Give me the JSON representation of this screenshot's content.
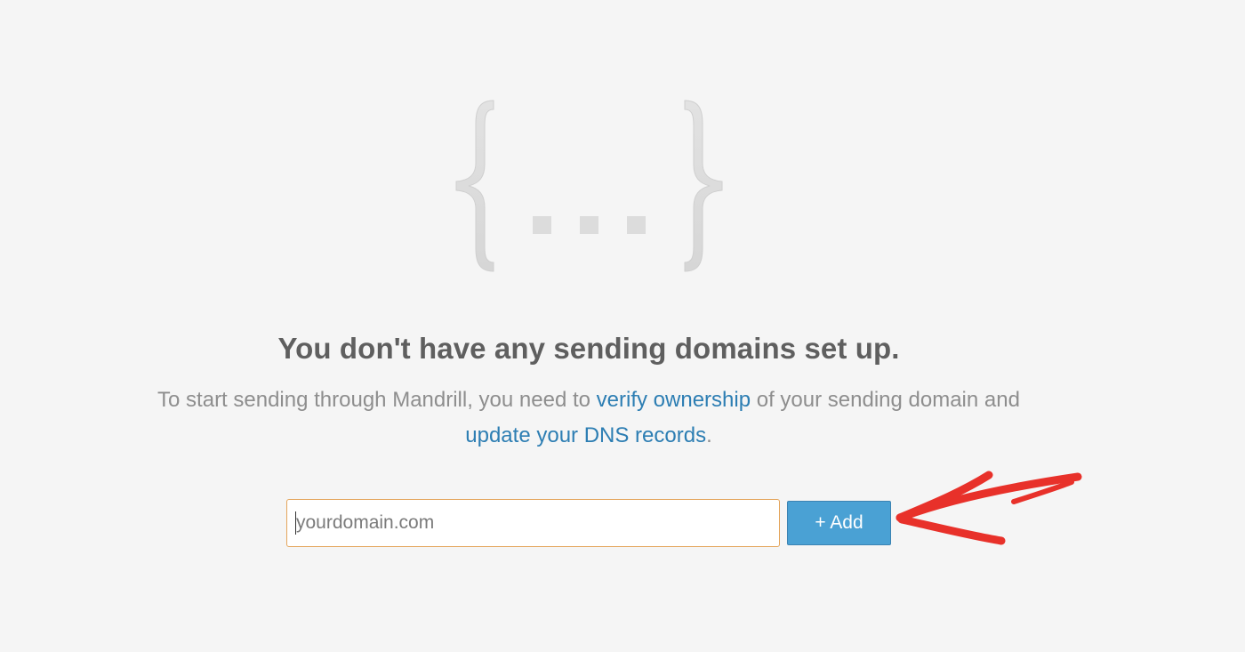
{
  "empty_state": {
    "headline": "You don't have any sending domains set up.",
    "description": {
      "part1": "To start sending through Mandrill, you need to ",
      "link1": "verify ownership",
      "part2": " of your sending domain and ",
      "link2": "update your DNS records",
      "part3": "."
    }
  },
  "domain_form": {
    "input_placeholder": "yourdomain.com",
    "input_value": "",
    "add_button_label": "+ Add"
  },
  "colors": {
    "background": "#f5f5f5",
    "link": "#2d7eb3",
    "button": "#4aa1d4",
    "input_focus_border": "#e4a55c",
    "annotation_arrow": "#e8312a"
  },
  "icons": {
    "illustration": "curly-braces-ellipsis-icon",
    "annotation": "red-arrow-annotation"
  }
}
